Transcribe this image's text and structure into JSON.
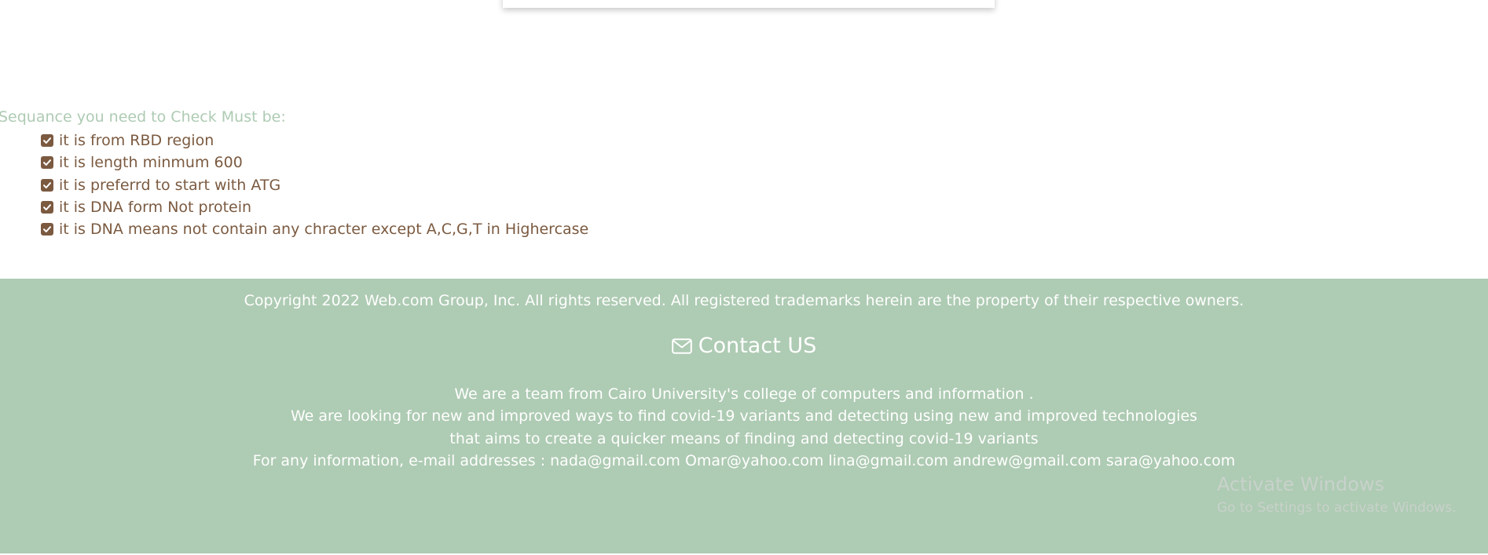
{
  "requirements": {
    "heading": "Sequance you need to Check Must be:",
    "items": [
      {
        "label": "it is from RBD region",
        "checked": true
      },
      {
        "label": "it is length minmum 600",
        "checked": true
      },
      {
        "label": "it is preferrd to start with ATG",
        "checked": true
      },
      {
        "label": "it is DNA form Not protein",
        "checked": true
      },
      {
        "label": "it is DNA means not contain any chracter except A,C,G,T in Highercase",
        "checked": true
      }
    ]
  },
  "footer": {
    "copyright": "Copyright 2022 Web.com Group, Inc. All rights reserved. All registered trademarks herein are the property of their respective owners.",
    "contact_title": "Contact US",
    "contact_icon": "envelope-icon",
    "about_lines": [
      "We are a team from Cairo University's college of computers and information .",
      "We are looking for new and improved ways to find covid-19 variants and detecting using new and improved technologies",
      "that aims to create a quicker means of finding and detecting covid-19 variants",
      "For any information, e-mail addresses : nada@gmail.com Omar@yahoo.com lina@gmail.com andrew@gmail.com sara@yahoo.com"
    ]
  },
  "watermark": {
    "title": "Activate Windows",
    "subtitle": "Go to Settings to activate Windows."
  },
  "colors": {
    "accent_green": "#aecbb3",
    "text_brown": "#7b5a40",
    "footer_text": "#ffffff"
  }
}
